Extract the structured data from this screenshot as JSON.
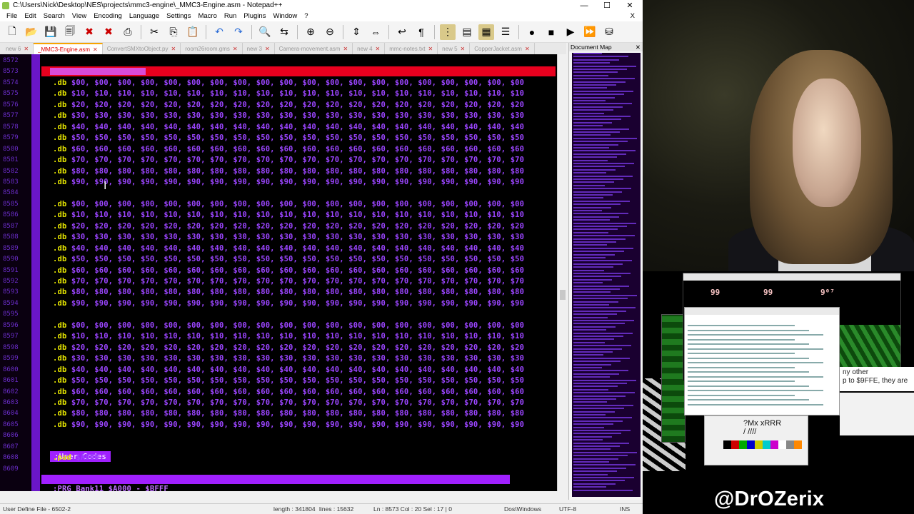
{
  "window": {
    "title": "C:\\Users\\Nick\\Desktop\\NES\\projects\\mmc3-engine\\_MMC3-Engine.asm - Notepad++",
    "minimize": "—",
    "maximize": "☐",
    "close": "✕"
  },
  "menu": [
    "File",
    "Edit",
    "Search",
    "View",
    "Encoding",
    "Language",
    "Settings",
    "Macro",
    "Run",
    "Plugins",
    "Window",
    "?"
  ],
  "close_x": "X",
  "toolbar_icons": [
    "new-file-icon",
    "open-file-icon",
    "save-icon",
    "save-all-icon",
    "close-icon",
    "close-all-icon",
    "print-icon",
    "cut-icon",
    "copy-icon",
    "paste-icon",
    "undo-icon",
    "redo-icon",
    "find-icon",
    "replace-icon",
    "zoom-in-icon",
    "zoom-out-icon",
    "sync-vertical-icon",
    "sync-horizontal-icon",
    "word-wrap-icon",
    "show-all-chars-icon",
    "indent-guide-icon",
    "udl-icon",
    "doc-map-icon",
    "function-list-icon",
    "record-macro-icon",
    "stop-record-icon",
    "play-macro-icon",
    "run-macro-multiple-icon",
    "save-macro-icon"
  ],
  "tabs": [
    {
      "label": "new 6",
      "active": false
    },
    {
      "label": "_MMC3-Engine.asm",
      "active": true
    },
    {
      "label": "ConvertSMXtoObject.py",
      "active": false
    },
    {
      "label": "room26room.gms",
      "active": false
    },
    {
      "label": "new 3",
      "active": false
    },
    {
      "label": "Camera-movement.asm",
      "active": false
    },
    {
      "label": "new 4",
      "active": false
    },
    {
      "label": "mmc-notes.txt",
      "active": false
    },
    {
      "label": "new 5",
      "active": false
    },
    {
      "label": "CopperJacket.asm",
      "active": false
    }
  ],
  "editor": {
    "line_numbers": [
      "8572",
      "8573",
      "8574",
      "8575",
      "8576",
      "8577",
      "8578",
      "8579",
      "8580",
      "8581",
      "8582",
      "8583",
      "8584",
      "8585",
      "8586",
      "8587",
      "8588",
      "8589",
      "8590",
      "8591",
      "8592",
      "8593",
      "8594",
      "8595",
      "8596",
      "8597",
      "8598",
      "8599",
      "8600",
      "8601",
      "8602",
      "8603",
      "8604",
      "8605",
      "8606",
      "8607",
      "8608",
      "8609"
    ],
    "lines": [
      "",
      "",
      ".db $00, $00, $00, $00, $00, $00, $00, $00, $00, $00, $00, $00, $00, $00, $00, $00, $00, $00, $00, $00",
      ".db $10, $10, $10, $10, $10, $10, $10, $10, $10, $10, $10, $10, $10, $10, $10, $10, $10, $10, $10, $10",
      ".db $20, $20, $20, $20, $20, $20, $20, $20, $20, $20, $20, $20, $20, $20, $20, $20, $20, $20, $20, $20",
      ".db $30, $30, $30, $30, $30, $30, $30, $30, $30, $30, $30, $30, $30, $30, $30, $30, $30, $30, $30, $30",
      ".db $40, $40, $40, $40, $40, $40, $40, $40, $40, $40, $40, $40, $40, $40, $40, $40, $40, $40, $40, $40",
      ".db $50, $50, $50, $50, $50, $50, $50, $50, $50, $50, $50, $50, $50, $50, $50, $50, $50, $50, $50, $50",
      ".db $60, $60, $60, $60, $60, $60, $60, $60, $60, $60, $60, $60, $60, $60, $60, $60, $60, $60, $60, $60",
      ".db $70, $70, $70, $70, $70, $70, $70, $70, $70, $70, $70, $70, $70, $70, $70, $70, $70, $70, $70, $70",
      ".db $80, $80, $80, $80, $80, $80, $80, $80, $80, $80, $80, $80, $80, $80, $80, $80, $80, $80, $80, $80",
      ".db $90, $90, $90, $90, $90, $90, $90, $90, $90, $90, $90, $90, $90, $90, $90, $90, $90, $90, $90, $90",
      "",
      ".db $00, $00, $00, $00, $00, $00, $00, $00, $00, $00, $00, $00, $00, $00, $00, $00, $00, $00, $00, $00",
      ".db $10, $10, $10, $10, $10, $10, $10, $10, $10, $10, $10, $10, $10, $10, $10, $10, $10, $10, $10, $10",
      ".db $20, $20, $20, $20, $20, $20, $20, $20, $20, $20, $20, $20, $20, $20, $20, $20, $20, $20, $20, $20",
      ".db $30, $30, $30, $30, $30, $30, $30, $30, $30, $30, $30, $30, $30, $30, $30, $30, $30, $30, $30, $30",
      ".db $40, $40, $40, $40, $40, $40, $40, $40, $40, $40, $40, $40, $40, $40, $40, $40, $40, $40, $40, $40",
      ".db $50, $50, $50, $50, $50, $50, $50, $50, $50, $50, $50, $50, $50, $50, $50, $50, $50, $50, $50, $50",
      ".db $60, $60, $60, $60, $60, $60, $60, $60, $60, $60, $60, $60, $60, $60, $60, $60, $60, $60, $60, $60",
      ".db $70, $70, $70, $70, $70, $70, $70, $70, $70, $70, $70, $70, $70, $70, $70, $70, $70, $70, $70, $70",
      ".db $80, $80, $80, $80, $80, $80, $80, $80, $80, $80, $80, $80, $80, $80, $80, $80, $80, $80, $80, $80",
      ".db $90, $90, $90, $90, $90, $90, $90, $90, $90, $90, $90, $90, $90, $90, $90, $90, $90, $90, $90, $90",
      "",
      ".db $00, $00, $00, $00, $00, $00, $00, $00, $00, $00, $00, $00, $00, $00, $00, $00, $00, $00, $00, $00",
      ".db $10, $10, $10, $10, $10, $10, $10, $10, $10, $10, $10, $10, $10, $10, $10, $10, $10, $10, $10, $10",
      ".db $20, $20, $20, $20, $20, $20, $20, $20, $20, $20, $20, $20, $20, $20, $20, $20, $20, $20, $20, $20",
      ".db $30, $30, $30, $30, $30, $30, $30, $30, $30, $30, $30, $30, $30, $30, $30, $30, $30, $30, $30, $30",
      ".db $40, $40, $40, $40, $40, $40, $40, $40, $40, $40, $40, $40, $40, $40, $40, $40, $40, $40, $40, $40",
      ".db $50, $50, $50, $50, $50, $50, $50, $50, $50, $50, $50, $50, $50, $50, $50, $50, $50, $50, $50, $50",
      ".db $60, $60, $60, $60, $60, $60, $60, $60, $60, $60, $60, $60, $60, $60, $60, $60, $60, $60, $60, $60",
      ".db $70, $70, $70, $70, $70, $70, $70, $70, $70, $70, $70, $70, $70, $70, $70, $70, $70, $70, $70, $70",
      ".db $80, $80, $80, $80, $80, $80, $80, $80, $80, $80, $80, $80, $80, $80, $80, $80, $80, $80, $80, $80",
      ".db $90, $90, $90, $90, $90, $90, $90, $90, $90, $90, $90, $90, $90, $90, $90, $90, $90, $90, $90, $90",
      "",
      "",
      ".pad $A000",
      ""
    ],
    "label_user_codes": ";User Codes",
    "partial_next": ";PRG Bank11 $A000 - $BFFF"
  },
  "docmap": {
    "title": "Document Map",
    "close": "✕"
  },
  "status": {
    "lang": "User Define File - 6502-2",
    "length": "length : 341804",
    "lines": "lines : 15632",
    "pos": "Ln : 8573   Col : 20   Sel : 17 | 0",
    "eol": "Dos\\Windows",
    "enc": "UTF-8",
    "mode": "INS"
  },
  "overlay": {
    "scores": [
      "99",
      "99",
      "9⁰⁷"
    ],
    "text_panel": "ny other\np to $9FFE, they are",
    "paint_text": "?Mx xRRR",
    "paint_strokes": "/ ////"
  },
  "handle": "@DrOZerix",
  "colors": {
    "editor_bg": "#000000",
    "code_purple": "#9b45ff",
    "directive_yellow": "#e6e600",
    "fold_margin": "#6a16c8",
    "highlight_red": "#e8001e"
  }
}
